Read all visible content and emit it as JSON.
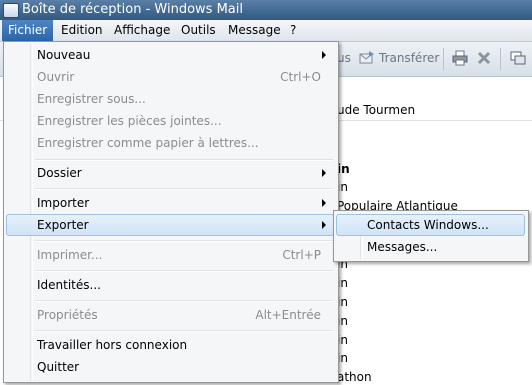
{
  "window": {
    "title": "Boîte de réception - Windows Mail"
  },
  "menubar": [
    "Fichier",
    "Edition",
    "Affichage",
    "Outils",
    "Message",
    "?"
  ],
  "toolbar": {
    "reply_fragment": "us",
    "forward": "Transférer"
  },
  "background_list": {
    "rows": [
      "ude Tourmen",
      "in",
      "in",
      "Populaire Atlantique",
      "in",
      "in",
      "in",
      "in",
      "in",
      "in",
      "athon"
    ]
  },
  "file_menu": {
    "items": [
      {
        "label": "Nouveau",
        "shortcut": "",
        "submenu": true,
        "disabled": false
      },
      {
        "label": "Ouvrir",
        "shortcut": "Ctrl+O",
        "submenu": false,
        "disabled": true
      },
      {
        "label": "Enregistrer sous...",
        "shortcut": "",
        "submenu": false,
        "disabled": true
      },
      {
        "label": "Enregistrer les pièces jointes...",
        "shortcut": "",
        "submenu": false,
        "disabled": true
      },
      {
        "label": "Enregistrer comme papier à lettres...",
        "shortcut": "",
        "submenu": false,
        "disabled": true
      },
      {
        "label": "Dossier",
        "shortcut": "",
        "submenu": true,
        "disabled": false
      },
      {
        "label": "Importer",
        "shortcut": "",
        "submenu": true,
        "disabled": false
      },
      {
        "label": "Exporter",
        "shortcut": "",
        "submenu": true,
        "disabled": false,
        "highlighted": true
      },
      {
        "label": "Imprimer...",
        "shortcut": "Ctrl+P",
        "submenu": false,
        "disabled": true
      },
      {
        "label": "Identités...",
        "shortcut": "",
        "submenu": false,
        "disabled": false
      },
      {
        "label": "Propriétés",
        "shortcut": "Alt+Entrée",
        "submenu": false,
        "disabled": true
      },
      {
        "label": "Travailler hors connexion",
        "shortcut": "",
        "submenu": false,
        "disabled": false
      },
      {
        "label": "Quitter",
        "shortcut": "",
        "submenu": false,
        "disabled": false
      }
    ]
  },
  "export_submenu": {
    "items": [
      {
        "label": "Contacts Windows...",
        "highlighted": true
      },
      {
        "label": "Messages..."
      }
    ]
  }
}
